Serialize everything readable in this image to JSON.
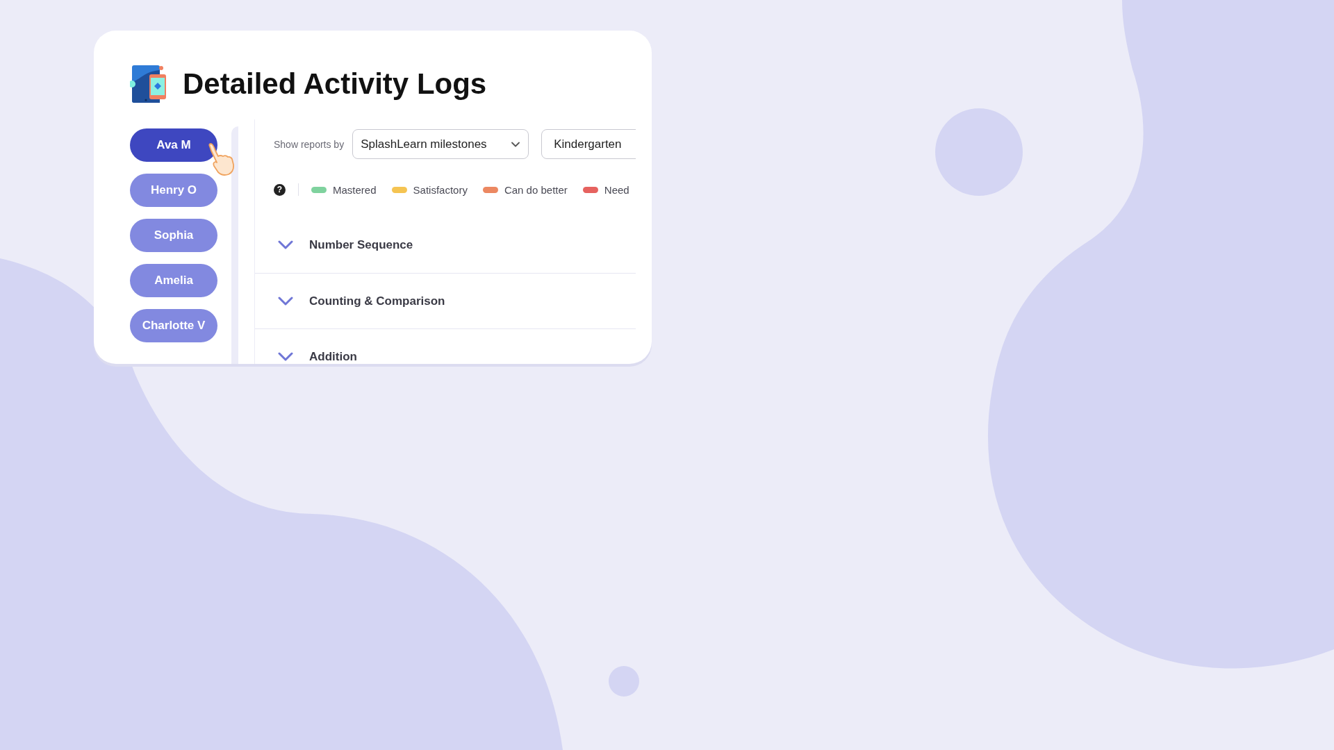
{
  "title": "Detailed Activity Logs",
  "students": [
    {
      "name": "Ava M",
      "selected": true
    },
    {
      "name": "Henry O",
      "selected": false
    },
    {
      "name": "Sophia",
      "selected": false
    },
    {
      "name": "Amelia",
      "selected": false
    },
    {
      "name": "Charlotte V",
      "selected": false
    }
  ],
  "filters": {
    "label": "Show reports by",
    "report_type": "SplashLearn milestones",
    "grade": "Kindergarten"
  },
  "help_icon": "?",
  "legend": [
    {
      "label": "Mastered",
      "color": "#7fd29e"
    },
    {
      "label": "Satisfactory",
      "color": "#f5c452"
    },
    {
      "label": "Can do better",
      "color": "#ec8861"
    },
    {
      "label": "Need",
      "color": "#e6625f"
    }
  ],
  "topics": [
    {
      "name": "Number Sequence"
    },
    {
      "name": "Counting & Comparison"
    },
    {
      "name": "Addition"
    }
  ]
}
